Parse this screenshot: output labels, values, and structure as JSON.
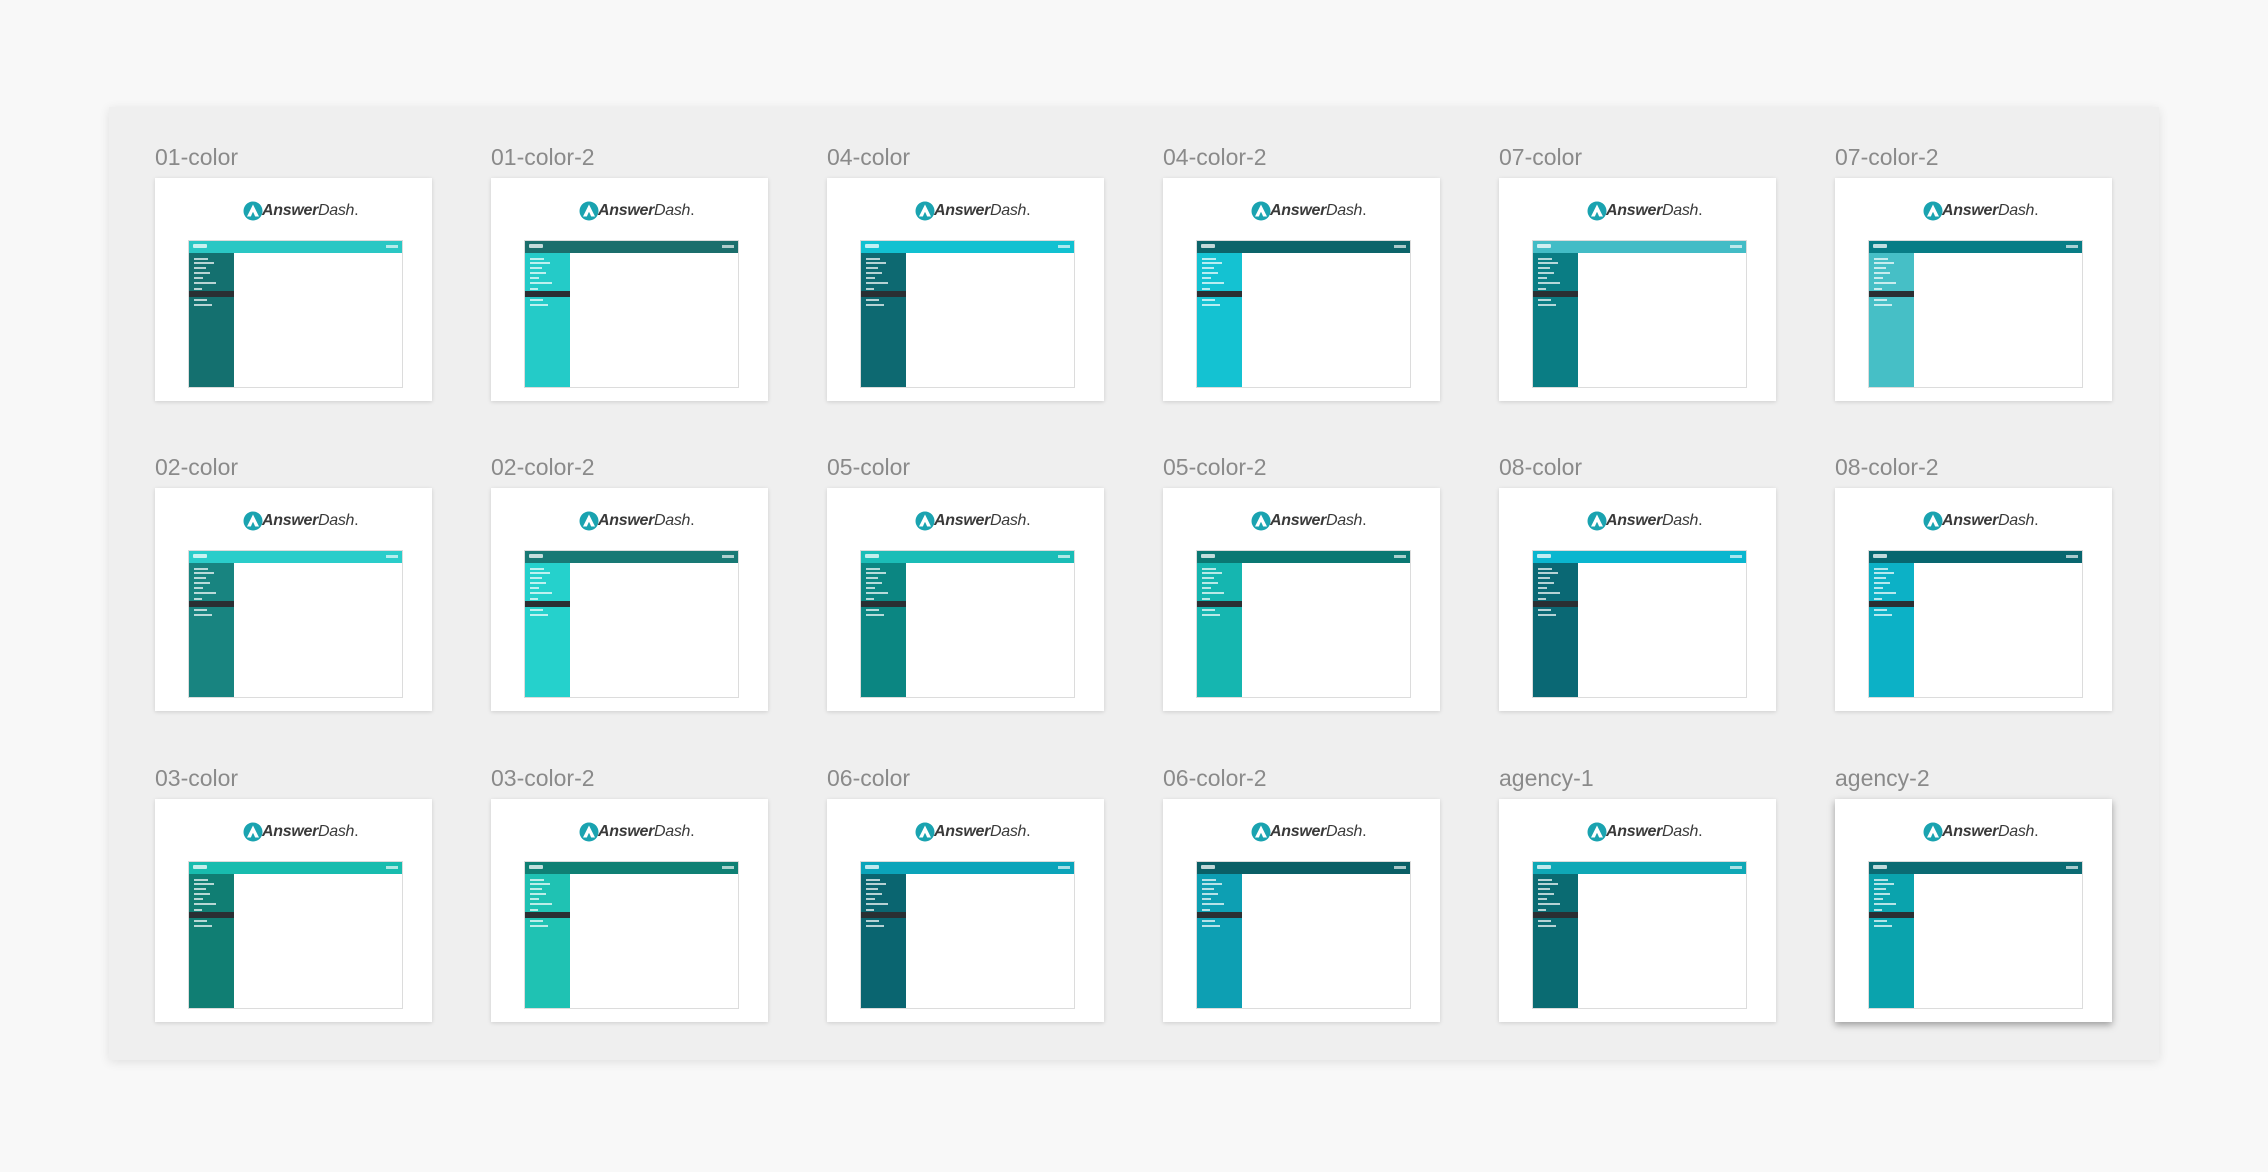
{
  "app": {
    "logo": {
      "bold": "Answer",
      "italic": "Dash",
      "dot": ".",
      "icon": "answerdash-logo-icon"
    }
  },
  "artboards": [
    {
      "label": "01-color",
      "topbar": "#2ac7c4",
      "sidebar": "#14706f"
    },
    {
      "label": "01-color-2",
      "topbar": "#1b6e6c",
      "sidebar": "#24cbc8"
    },
    {
      "label": "04-color",
      "topbar": "#12c1d1",
      "sidebar": "#0d6971"
    },
    {
      "label": "04-color-2",
      "topbar": "#0c646a",
      "sidebar": "#14c2d2"
    },
    {
      "label": "07-color",
      "topbar": "#43bcc6",
      "sidebar": "#0a7d84"
    },
    {
      "label": "07-color-2",
      "topbar": "#087d86",
      "sidebar": "#46bfc6"
    },
    {
      "label": "02-color",
      "topbar": "#2acdca",
      "sidebar": "#188480"
    },
    {
      "label": "02-color-2",
      "topbar": "#187975",
      "sidebar": "#25d1cc"
    },
    {
      "label": "05-color",
      "topbar": "#1bbdb7",
      "sidebar": "#0b8682"
    },
    {
      "label": "05-color-2",
      "topbar": "#0a7873",
      "sidebar": "#15b6b0"
    },
    {
      "label": "08-color",
      "topbar": "#0ab6cf",
      "sidebar": "#0a6874"
    },
    {
      "label": "08-color-2",
      "topbar": "#08666f",
      "sidebar": "#0cb1c6"
    },
    {
      "label": "03-color",
      "topbar": "#18bcae",
      "sidebar": "#107e73"
    },
    {
      "label": "03-color-2",
      "topbar": "#0f8074",
      "sidebar": "#1fc2b3"
    },
    {
      "label": "06-color",
      "topbar": "#0ba4ba",
      "sidebar": "#0a6570"
    },
    {
      "label": "06-color-2",
      "topbar": "#0a5f66",
      "sidebar": "#0d9fb3"
    },
    {
      "label": "agency-1",
      "topbar": "#0fa8b6",
      "sidebar": "#0a6b72"
    },
    {
      "label": "agency-2",
      "topbar": "#0b6b73",
      "sidebar": "#0aa3ad"
    }
  ],
  "selected_artboard": "agency-2"
}
